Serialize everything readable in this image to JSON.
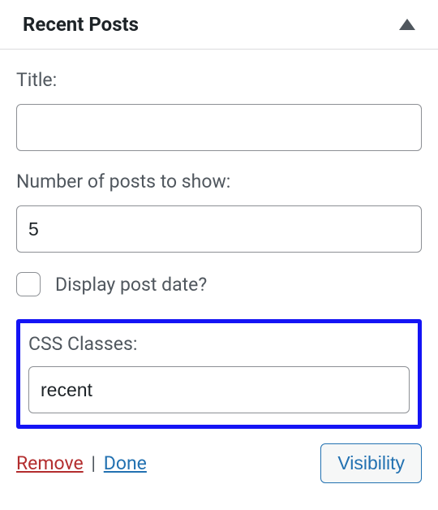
{
  "header": {
    "title": "Recent Posts"
  },
  "form": {
    "title_label": "Title:",
    "title_value": "",
    "posts_count_label": "Number of posts to show:",
    "posts_count_value": "5",
    "display_date_label": "Display post date?",
    "display_date_checked": false,
    "css_classes_label": "CSS Classes:",
    "css_classes_value": "recent"
  },
  "footer": {
    "remove_label": "Remove",
    "separator": "|",
    "done_label": "Done",
    "visibility_label": "Visibility"
  }
}
